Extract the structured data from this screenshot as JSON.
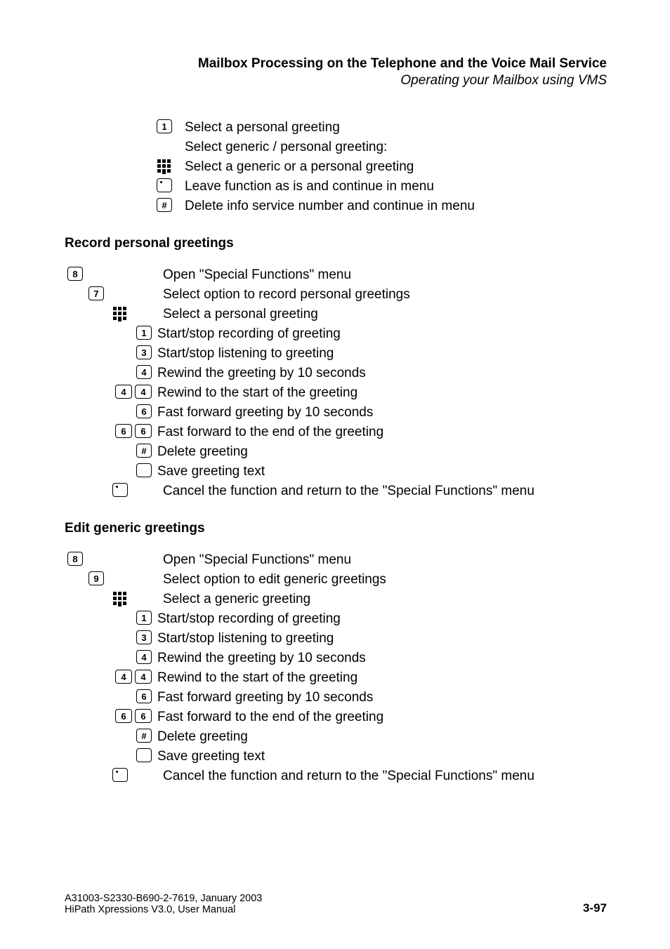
{
  "header": {
    "title": "Mailbox Processing on the Telephone and the Voice Mail Service",
    "subtitle": "Operating your Mailbox using VMS"
  },
  "intro_rows": [
    {
      "keys": [
        "1"
      ],
      "indent": 127,
      "keyw": 26,
      "text": "Select a personal greeting"
    },
    {
      "keys": [],
      "indent": 127,
      "keyw": 26,
      "text": "Select generic / personal greeting:"
    },
    {
      "keys": [
        "PAD"
      ],
      "indent": 127,
      "keyw": 26,
      "text": "Select a generic or a personal greeting"
    },
    {
      "keys": [
        "BLANK_DOT"
      ],
      "indent": 127,
      "keyw": 26,
      "text": "Leave function as is and continue in menu"
    },
    {
      "keys": [
        "#"
      ],
      "indent": 127,
      "keyw": 26,
      "text": "Delete info service number and continue in menu"
    }
  ],
  "sections": [
    {
      "heading": "Record personal greetings",
      "rows": [
        {
          "keys": [
            "8"
          ],
          "indent": 0,
          "keyw": 26,
          "text": "Open \"Special Functions\" menu"
        },
        {
          "keys": [
            "7"
          ],
          "indent": 30,
          "keyw": 26,
          "text": "Select option to record personal greetings"
        },
        {
          "keys": [
            "PAD"
          ],
          "indent": 64,
          "keyw": 26,
          "text": "Select a personal greeting"
        },
        {
          "keys": [
            "1"
          ],
          "indent": 98,
          "keyw": 26,
          "textpad": 8,
          "text": "Start/stop recording of greeting"
        },
        {
          "keys": [
            "3"
          ],
          "indent": 98,
          "keyw": 26,
          "textpad": 8,
          "text": "Start/stop listening to greeting"
        },
        {
          "keys": [
            "4"
          ],
          "indent": 98,
          "keyw": 26,
          "textpad": 8,
          "text": "Rewind the greeting by 10 seconds"
        },
        {
          "keys": [
            "4",
            "4"
          ],
          "indent": 68,
          "keyw": 56,
          "textpad": 8,
          "text": "Rewind to the start of the greeting"
        },
        {
          "keys": [
            "6"
          ],
          "indent": 98,
          "keyw": 26,
          "textpad": 8,
          "text": "Fast forward greeting by 10 seconds"
        },
        {
          "keys": [
            "6",
            "6"
          ],
          "indent": 68,
          "keyw": 56,
          "textpad": 8,
          "text": "Fast forward to the end of the greeting"
        },
        {
          "keys": [
            "#"
          ],
          "indent": 98,
          "keyw": 26,
          "textpad": 8,
          "text": "Delete greeting"
        },
        {
          "keys": [
            "BLANK"
          ],
          "indent": 98,
          "keyw": 26,
          "textpad": 8,
          "text": "Save greeting text"
        },
        {
          "keys": [
            "BLANK_DOT"
          ],
          "indent": 64,
          "keyw": 26,
          "text": "Cancel the function and return to the \"Special Functions\" menu"
        }
      ]
    },
    {
      "heading": "Edit generic greetings",
      "rows": [
        {
          "keys": [
            "8"
          ],
          "indent": 0,
          "keyw": 26,
          "text": "Open \"Special Functions\" menu"
        },
        {
          "keys": [
            "9"
          ],
          "indent": 30,
          "keyw": 26,
          "text": "Select option to edit generic greetings"
        },
        {
          "keys": [
            "PAD"
          ],
          "indent": 64,
          "keyw": 26,
          "text": "Select a generic greeting"
        },
        {
          "keys": [
            "1"
          ],
          "indent": 98,
          "keyw": 26,
          "textpad": 8,
          "text": "Start/stop recording of greeting"
        },
        {
          "keys": [
            "3"
          ],
          "indent": 98,
          "keyw": 26,
          "textpad": 8,
          "text": "Start/stop listening to greeting"
        },
        {
          "keys": [
            "4"
          ],
          "indent": 98,
          "keyw": 26,
          "textpad": 8,
          "text": "Rewind the greeting by 10 seconds"
        },
        {
          "keys": [
            "4",
            "4"
          ],
          "indent": 68,
          "keyw": 56,
          "textpad": 8,
          "text": "Rewind to the start of the greeting"
        },
        {
          "keys": [
            "6"
          ],
          "indent": 98,
          "keyw": 26,
          "textpad": 8,
          "text": "Fast forward greeting by 10 seconds"
        },
        {
          "keys": [
            "6",
            "6"
          ],
          "indent": 68,
          "keyw": 56,
          "textpad": 8,
          "text": "Fast forward to the end of the greeting"
        },
        {
          "keys": [
            "#"
          ],
          "indent": 98,
          "keyw": 26,
          "textpad": 8,
          "text": "Delete greeting"
        },
        {
          "keys": [
            "BLANK"
          ],
          "indent": 98,
          "keyw": 26,
          "textpad": 8,
          "text": "Save greeting text"
        },
        {
          "keys": [
            "BLANK_DOT"
          ],
          "indent": 64,
          "keyw": 26,
          "text": "Cancel the function and return to the \"Special Functions\" menu"
        }
      ]
    }
  ],
  "footer": {
    "line1": "A31003-S2330-B690-2-7619, January 2003",
    "line2": "HiPath Xpressions V3.0, User Manual",
    "page": "3-97"
  }
}
